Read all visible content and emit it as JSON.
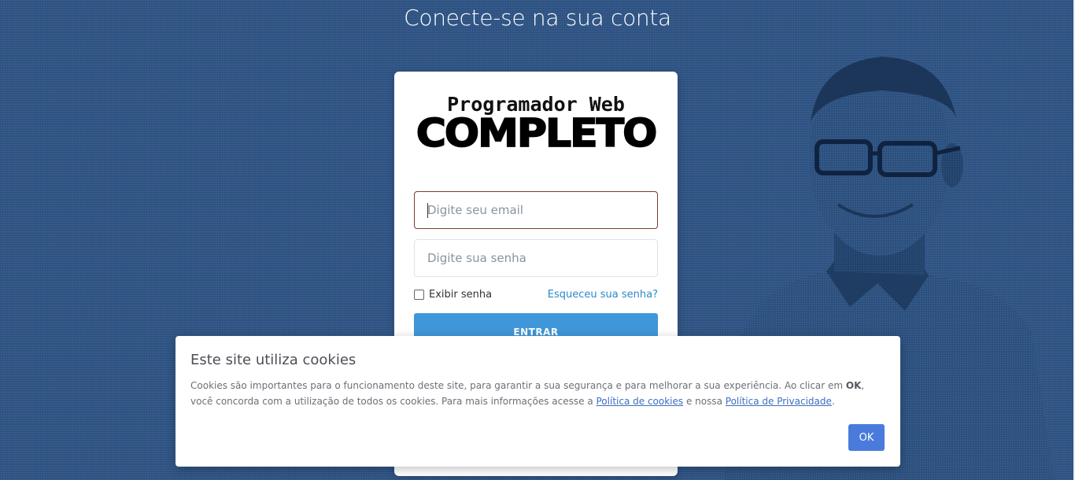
{
  "page": {
    "heading": "Conecte-se na sua conta"
  },
  "logo": {
    "line1": "Programador Web",
    "line2": "COMPLETO"
  },
  "login": {
    "email_placeholder": "Digite seu email",
    "password_placeholder": "Digite sua senha",
    "show_password_label": "Exibir senha",
    "forgot_link": "Esqueceu sua senha?",
    "submit_label": "ENTRAR"
  },
  "cookies": {
    "title": "Este site utiliza cookies",
    "text_part1": "Cookies são importantes para o funcionamento deste site, para garantir a sua segurança e para melhorar a sua experiência. Ao clicar em ",
    "text_bold": "OK",
    "text_part2": ", você concorda com a utilização de todos os cookies. Para mais informações acesse a ",
    "cookie_policy_link": "Política de cookies",
    "text_part3": " e nossa ",
    "privacy_policy_link": "Política de Privacidade",
    "text_part4": ".",
    "ok_label": "OK"
  },
  "colors": {
    "background": "#2f5586",
    "primary_button": "#3f96d8",
    "ok_button": "#4a7bdc",
    "link": "#2a89c8"
  }
}
